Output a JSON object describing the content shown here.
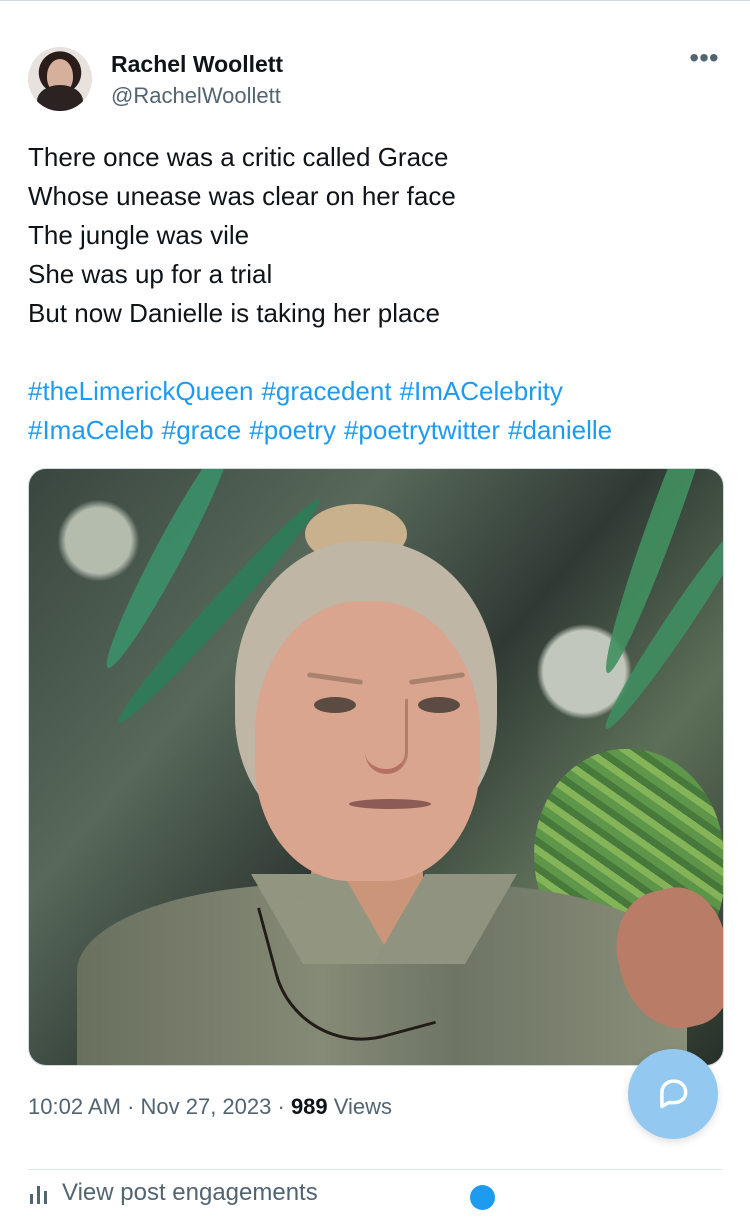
{
  "post": {
    "author": {
      "name": "Rachel Woollett",
      "handle": "@RachelWoollett",
      "avatar_icon": "avatar-portrait-icon"
    },
    "more_icon": "more-horizontal-icon",
    "text_lines": [
      "There once was a critic called Grace",
      "Whose unease was clear on her face",
      "The jungle was vile",
      "She was up for a trial",
      "But now Danielle is taking her place"
    ],
    "hashtags": [
      "#theLimerickQueen",
      "#gracedent",
      "#ImACelebrity",
      "#ImaCeleb",
      "#grace",
      "#poetry",
      "#poetrytwitter",
      "#danielle"
    ],
    "timestamp": "10:02 AM · Nov 27, 2023 · ",
    "views_count": "989",
    "views_label": " Views",
    "engagements_label": "View post engagements"
  },
  "colors": {
    "text": "#0f1419",
    "secondary_text": "#536471",
    "link": "#1d9bf0",
    "floating_button": "#93c9f0"
  },
  "icons": {
    "floating_button": "reply-bubble-icon",
    "engagements": "analytics-icon"
  }
}
